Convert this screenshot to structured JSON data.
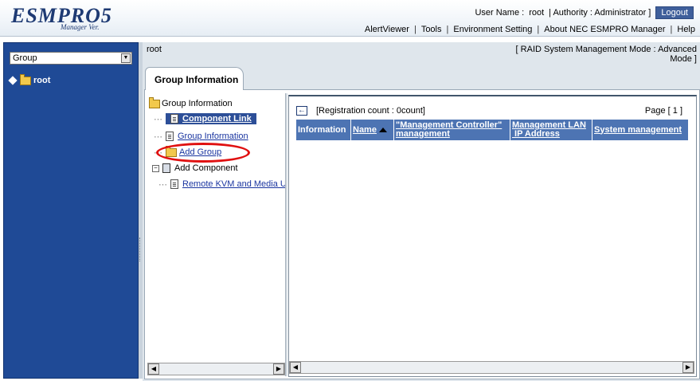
{
  "header": {
    "logo_text": "ESMPRO5",
    "logo_sub": "Manager Ver.",
    "user_label": "User Name :",
    "user_name": "root",
    "authority_label": "| Authority : Administrator ]",
    "logout": "Logout",
    "menu": [
      "AlertViewer",
      "Tools",
      "Environment Setting",
      "About NEC ESMPRO Manager",
      "Help"
    ],
    "separator": "|"
  },
  "sidebar": {
    "select_value": "Group",
    "tree_root": "root"
  },
  "main": {
    "path": "root",
    "mode_line1": "[ RAID System Management Mode : Advanced",
    "mode_line2": "Mode ]",
    "tab_label": "Group Information"
  },
  "tree": {
    "root_label": "Group Information",
    "items": [
      {
        "label": "Component Link"
      },
      {
        "label": "Group Information"
      },
      {
        "label": "Add Group"
      },
      {
        "label": "Add Component"
      },
      {
        "label": "Remote KVM and Media U"
      }
    ]
  },
  "list": {
    "registration": "[Registration count : 0count]",
    "page_label": "Page [",
    "page_number": "1",
    "page_close": "]",
    "columns": [
      {
        "label": "Information"
      },
      {
        "label": "Name"
      },
      {
        "label1": "\"Management Controller\"",
        "label2": "management"
      },
      {
        "label1": "Management LAN",
        "label2": " IP Address"
      },
      {
        "label": "System management"
      }
    ]
  },
  "icons": {
    "back": "arrow-left-icon",
    "folder": "folder-icon",
    "document": "document-icon"
  },
  "colors": {
    "sidebar_bg": "#1f4a96",
    "header_col_bg": "#4d74b3",
    "selected_bg": "#2d4f98",
    "highlight_circle": "#e01010",
    "logout_bg": "#3f5f9b"
  }
}
